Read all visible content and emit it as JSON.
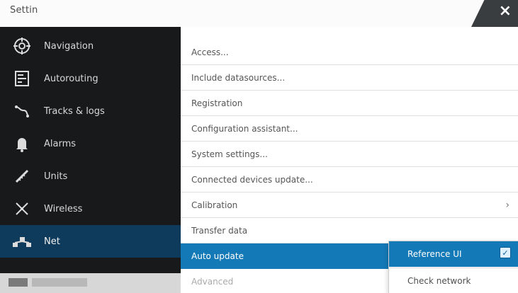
{
  "window": {
    "title": "Settin",
    "close_label": "×"
  },
  "sidebar": {
    "items": [
      {
        "label": "Navigation",
        "icon": "chart-icon"
      },
      {
        "label": "Autorouting",
        "icon": "route-icon"
      },
      {
        "label": "Tracks & logs",
        "icon": "track-icon"
      },
      {
        "label": "Alarms",
        "icon": "alarm-bell-icon"
      },
      {
        "label": "Units",
        "icon": "ruler-icon"
      },
      {
        "label": "Wireless",
        "icon": "antenna-icon"
      },
      {
        "label": "Net",
        "icon": "network-icon",
        "active": true
      }
    ]
  },
  "menu": {
    "items": [
      {
        "label": "Access..."
      },
      {
        "label": "Include datasources..."
      },
      {
        "label": "Registration"
      },
      {
        "label": "Configuration assistant..."
      },
      {
        "label": "System settings..."
      },
      {
        "label": "Connected devices update..."
      },
      {
        "label": "Calibration",
        "has_arrow": true,
        "arrow": "›"
      },
      {
        "label": "Transfer data"
      },
      {
        "label": "Auto update",
        "selected": true
      },
      {
        "label": "Advanced",
        "faded": true
      }
    ]
  },
  "popup": {
    "selected_option": "Reference UI",
    "second_option": "Check network",
    "check_mark": "✓"
  },
  "colors": {
    "sidebar": "#17191b",
    "sidebar_active": "#0e3a5b",
    "selection": "#1479b7",
    "titlebar": "#fbfbfb",
    "close_tab": "#3a3d40"
  }
}
